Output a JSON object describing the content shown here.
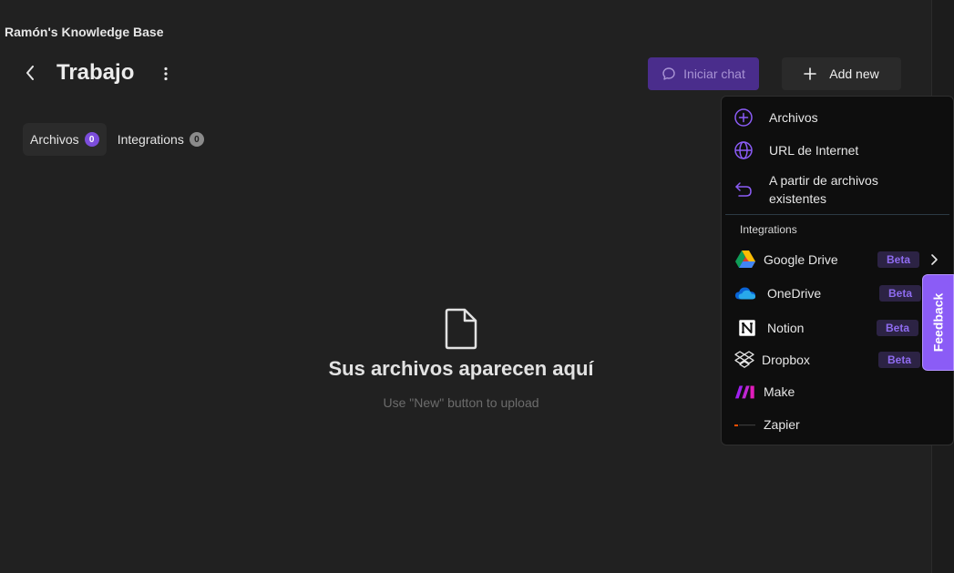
{
  "kb_title": "Ramón's Knowledge Base",
  "header": {
    "title": "Trabajo",
    "chat_label": "Iniciar chat",
    "add_label": "Add new"
  },
  "tabs": [
    {
      "label": "Archivos",
      "count": "0"
    },
    {
      "label": "Integrations",
      "count": "0"
    }
  ],
  "empty_state": {
    "title": "Sus archivos aparecen aquí",
    "subtitle": "Use \"New\" button to upload"
  },
  "dropdown": {
    "items": [
      {
        "label": "Archivos",
        "icon": "plus-circle-icon"
      },
      {
        "label": "URL de Internet",
        "icon": "globe-icon"
      },
      {
        "label": "A partir de archivos existentes",
        "icon": "undo-arrow-icon"
      }
    ],
    "section_label": "Integrations",
    "integrations": [
      {
        "label": "Google Drive",
        "badge": "Beta",
        "icon": "google-drive-icon"
      },
      {
        "label": "OneDrive",
        "badge": "Beta",
        "icon": "onedrive-icon"
      },
      {
        "label": "Notion",
        "badge": "Beta",
        "icon": "notion-icon"
      },
      {
        "label": "Dropbox",
        "badge": "Beta",
        "icon": "dropbox-icon"
      },
      {
        "label": "Make",
        "icon": "make-icon"
      },
      {
        "label": "Zapier",
        "icon": "zapier-icon"
      }
    ]
  },
  "feedback_label": "Feedback",
  "colors": {
    "accent": "#8b5cf6",
    "background": "#212121",
    "menu_background": "#0e0e0e"
  }
}
